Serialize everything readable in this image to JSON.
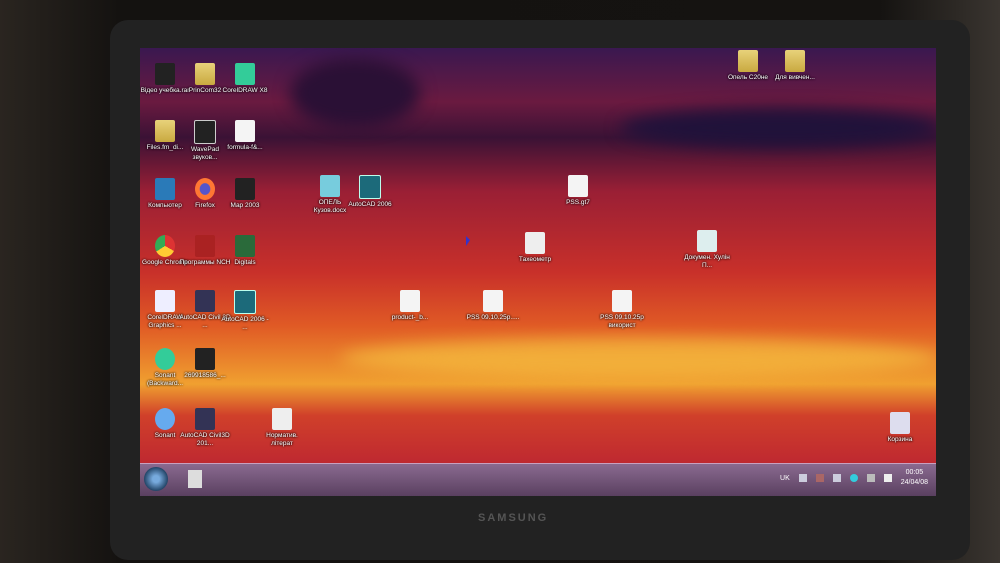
{
  "desktop_icons": [
    {
      "label": "Відео учебка.rar"
    },
    {
      "label": "PrinCom32"
    },
    {
      "label": "CorelDRAW X8"
    },
    {
      "label": "Files.fm_di..."
    },
    {
      "label": "WavePad звуков..."
    },
    {
      "label": "formula-f&..."
    },
    {
      "label": "Компьютер"
    },
    {
      "label": "Firefox"
    },
    {
      "label": "Map 2003"
    },
    {
      "label": "Google Chrome"
    },
    {
      "label": "Программы NCH"
    },
    {
      "label": "Digitals"
    },
    {
      "label": "CorelDRAW Graphics ..."
    },
    {
      "label": "AutoCAD Civil 3D ..."
    },
    {
      "label": "AutoCAD 2006 - ..."
    },
    {
      "label": "Sonant (Backward..."
    },
    {
      "label": "269918586_..."
    },
    {
      "label": "Sonant"
    },
    {
      "label": "AutoCAD Civil3D 201..."
    },
    {
      "label": "Норматив. літерат"
    },
    {
      "label": "ОПЕЛЬ Кузов.docx"
    },
    {
      "label": "AutoCAD 2006"
    },
    {
      "label": "PSS.gt7"
    },
    {
      "label": "Тахеометр"
    },
    {
      "label": "Докумен. Хулін П..."
    },
    {
      "label": "product-_b..."
    },
    {
      "label": "PSS 09.10.25p....."
    },
    {
      "label": "PSS 09.10.25p використ"
    },
    {
      "label": "Опель C20не"
    },
    {
      "label": "Для вивчен..."
    },
    {
      "label": "Корзина"
    }
  ],
  "taskbar": {
    "language": "UK",
    "time": "00:05",
    "date": "24/04/08"
  },
  "bezel": {
    "brand": "SAMSUNG"
  }
}
